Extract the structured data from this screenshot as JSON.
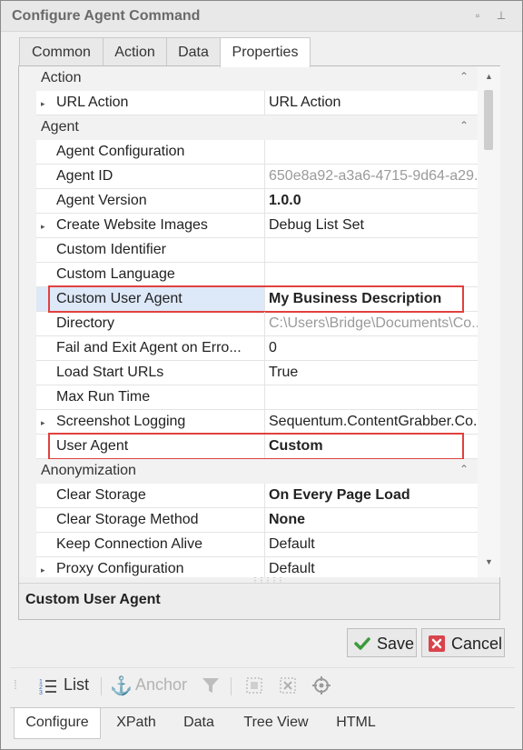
{
  "window": {
    "title": "Configure Agent Command",
    "pin_glyph": "▫",
    "unpin_glyph": "⊥"
  },
  "tabs": [
    {
      "label": "Common",
      "active": false
    },
    {
      "label": "Action",
      "active": false
    },
    {
      "label": "Data",
      "active": false
    },
    {
      "label": "Properties",
      "active": true
    }
  ],
  "grid": {
    "categories": [
      {
        "label": "Action",
        "rows": [
          {
            "name": "URL Action",
            "value": "URL Action",
            "expandable": true,
            "style": "normal"
          }
        ]
      },
      {
        "label": "Agent",
        "rows": [
          {
            "name": "Agent Configuration",
            "value": "",
            "expandable": false,
            "style": "normal"
          },
          {
            "name": "Agent ID",
            "value": "650e8a92-a3a6-4715-9d64-a29...",
            "expandable": false,
            "style": "gray"
          },
          {
            "name": "Agent Version",
            "value": "1.0.0",
            "expandable": false,
            "style": "bold"
          },
          {
            "name": "Create Website Images",
            "value": "Debug List Set",
            "expandable": true,
            "style": "normal"
          },
          {
            "name": "Custom Identifier",
            "value": "",
            "expandable": false,
            "style": "normal"
          },
          {
            "name": "Custom Language",
            "value": "",
            "expandable": false,
            "style": "normal"
          },
          {
            "name": "Custom User Agent",
            "value": "My Business Description",
            "expandable": false,
            "style": "bold",
            "selected": true,
            "highlighted": true
          },
          {
            "name": "Directory",
            "value": "C:\\Users\\Bridge\\Documents\\Co...",
            "expandable": false,
            "style": "gray"
          },
          {
            "name": "Fail and Exit Agent on Erro...",
            "value": "0",
            "expandable": false,
            "style": "normal"
          },
          {
            "name": "Load Start URLs",
            "value": "True",
            "expandable": false,
            "style": "normal"
          },
          {
            "name": "Max Run Time",
            "value": "",
            "expandable": false,
            "style": "normal"
          },
          {
            "name": "Screenshot Logging",
            "value": "Sequentum.ContentGrabber.Co...",
            "expandable": true,
            "style": "normal"
          },
          {
            "name": "User Agent",
            "value": "Custom",
            "expandable": false,
            "style": "bold",
            "highlighted": true
          }
        ]
      },
      {
        "label": "Anonymization",
        "rows": [
          {
            "name": "Clear Storage",
            "value": "On Every Page Load",
            "expandable": false,
            "style": "bold"
          },
          {
            "name": "Clear Storage Method",
            "value": "None",
            "expandable": false,
            "style": "bold"
          },
          {
            "name": "Keep Connection Alive",
            "value": "Default",
            "expandable": false,
            "style": "normal"
          },
          {
            "name": "Proxy Configuration",
            "value": "Default",
            "expandable": true,
            "style": "normal"
          }
        ]
      }
    ]
  },
  "description": {
    "title": "Custom User Agent"
  },
  "buttons": {
    "save_label": "Save",
    "cancel_label": "Cancel"
  },
  "toolbar": {
    "list_label": "List",
    "anchor_label": "Anchor"
  },
  "bottom_tabs": [
    {
      "label": "Configure",
      "active": true
    },
    {
      "label": "XPath",
      "active": false
    },
    {
      "label": "Data",
      "active": false
    },
    {
      "label": "Tree View",
      "active": false
    },
    {
      "label": "HTML",
      "active": false
    }
  ],
  "colors": {
    "highlight_border": "#e0413f",
    "selected_row": "#dde8f8",
    "save_check": "#3a9a3a",
    "cancel_red": "#d9434b"
  }
}
